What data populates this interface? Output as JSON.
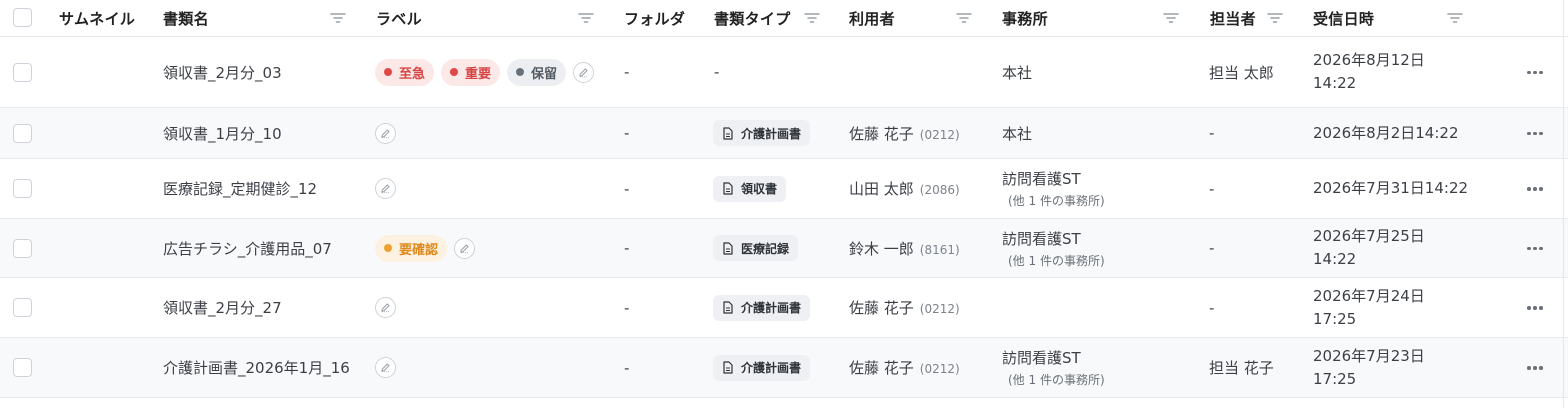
{
  "columns": {
    "thumbnail": "サムネイル",
    "doc_name": "書類名",
    "label": "ラベル",
    "folder": "フォルダ",
    "doc_type": "書類タイプ",
    "user": "利用者",
    "office": "事務所",
    "assignee": "担当者",
    "received": "受信日時"
  },
  "tag_colors": {
    "至急": {
      "bg": "#fde8e8",
      "fg": "#d64545",
      "dot": "#e04848"
    },
    "重要": {
      "bg": "#fde8e8",
      "fg": "#d64545",
      "dot": "#e04848"
    },
    "保留": {
      "bg": "#eceef1",
      "fg": "#555b63",
      "dot": "#6b7178"
    },
    "要確認": {
      "bg": "#fdf1e1",
      "fg": "#e08a1e",
      "dot": "#f0a030"
    }
  },
  "rows": [
    {
      "name": "領収書_2月分_03",
      "labels": [
        "至急",
        "重要",
        "保留"
      ],
      "folder": "-",
      "doc_type": "-",
      "user_name": "",
      "user_code": "",
      "office": "本社",
      "office_sub": "",
      "assignee": "担当 太郎",
      "date_line1": "2026年8月12日",
      "date_line2": "14:22"
    },
    {
      "name": "領収書_1月分_10",
      "labels": [],
      "folder": "-",
      "doc_type": "介護計画書",
      "user_name": "佐藤 花子",
      "user_code": "(0212)",
      "office": "本社",
      "office_sub": "",
      "assignee": "-",
      "date_line1": "2026年8月2日14:22",
      "date_line2": ""
    },
    {
      "name": "医療記録_定期健診_12",
      "labels": [],
      "folder": "-",
      "doc_type": "領収書",
      "user_name": "山田 太郎",
      "user_code": "(2086)",
      "office": "訪問看護ST",
      "office_sub": "(他 1 件の事務所)",
      "assignee": "-",
      "date_line1": "2026年7月31日14:22",
      "date_line2": ""
    },
    {
      "name": "広告チラシ_介護用品_07",
      "labels": [
        "要確認"
      ],
      "folder": "-",
      "doc_type": "医療記録",
      "user_name": "鈴木 一郎",
      "user_code": "(8161)",
      "office": "訪問看護ST",
      "office_sub": "(他 1 件の事務所)",
      "assignee": "-",
      "date_line1": "2026年7月25日",
      "date_line2": "14:22"
    },
    {
      "name": "領収書_2月分_27",
      "labels": [],
      "folder": "-",
      "doc_type": "介護計画書",
      "user_name": "佐藤 花子",
      "user_code": "(0212)",
      "office": "",
      "office_sub": "",
      "assignee": "-",
      "date_line1": "2026年7月24日",
      "date_line2": "17:25"
    },
    {
      "name": "介護計画書_2026年1月_16",
      "labels": [],
      "folder": "-",
      "doc_type": "介護計画書",
      "user_name": "佐藤 花子",
      "user_code": "(0212)",
      "office": "訪問看護ST",
      "office_sub": "(他 1 件の事務所)",
      "assignee": "担当 花子",
      "date_line1": "2026年7月23日",
      "date_line2": "17:25"
    }
  ]
}
